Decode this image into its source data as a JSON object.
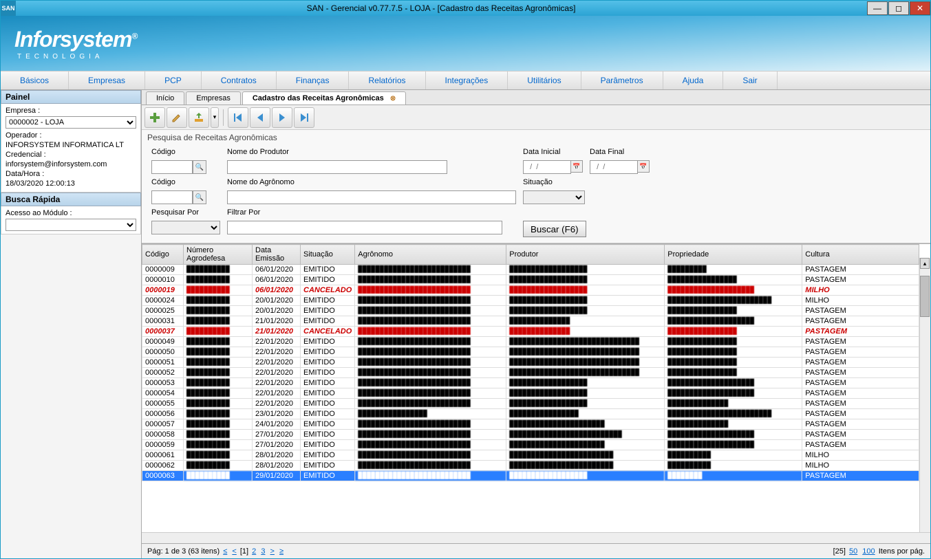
{
  "window": {
    "app_icon_text": "SAN",
    "title": "SAN - Gerencial v0.77.7.5 - LOJA - [Cadastro das Receitas Agronômicas]"
  },
  "logo": {
    "brand": "Inforsystem",
    "reg": "®",
    "sub": "TECNOLOGIA"
  },
  "menu": [
    "Básicos",
    "Empresas",
    "PCP",
    "Contratos",
    "Finanças",
    "Relatórios",
    "Integrações",
    "Utilitários",
    "Parâmetros",
    "Ajuda",
    "Sair"
  ],
  "side": {
    "panel_title": "Painel",
    "empresa_label": "Empresa :",
    "empresa_value": "0000002 - LOJA",
    "operador_label": "Operador :",
    "operador_value": "INFORSYSTEM INFORMATICA LT",
    "credencial_label": "Credencial :",
    "credencial_value": "inforsystem@inforsystem.com",
    "datahora_label": "Data/Hora :",
    "datahora_value": "18/03/2020 12:00:13",
    "busca_title": "Busca Rápida",
    "busca_label": "Acesso ao Módulo :"
  },
  "tabs": [
    {
      "label": "Início",
      "active": false,
      "closable": false
    },
    {
      "label": "Empresas",
      "active": false,
      "closable": false
    },
    {
      "label": "Cadastro das Receitas Agronômicas",
      "active": true,
      "closable": true
    }
  ],
  "form": {
    "heading": "Pesquisa de Receitas Agronômicas",
    "codigo_label": "Código",
    "produtor_label": "Nome do Produtor",
    "datai_label": "Data Inicial",
    "dataf_label": "Data Final",
    "date_placeholder": "  /  /",
    "agronomo_label": "Nome do Agrônomo",
    "situacao_label": "Situação",
    "pesquisar_label": "Pesquisar Por",
    "filtrar_label": "Filtrar Por",
    "buscar_label": "Buscar (F6)"
  },
  "grid": {
    "columns": [
      "Código",
      "Número Agrodefesa",
      "Data Emissão",
      "Situação",
      "Agrônomo",
      "Produtor",
      "Propriedade",
      "Cultura"
    ],
    "rows": [
      {
        "c": "0000009",
        "n": "██████████",
        "d": "06/01/2020",
        "s": "EMITIDO",
        "ag": "██████████████████████████",
        "pr": "██████████████████",
        "pp": "█████████",
        "cu": "PASTAGEM",
        "cancel": false,
        "sel": false
      },
      {
        "c": "0000010",
        "n": "██████████",
        "d": "06/01/2020",
        "s": "EMITIDO",
        "ag": "██████████████████████████",
        "pr": "██████████████████",
        "pp": "████████████████",
        "cu": "PASTAGEM",
        "cancel": false,
        "sel": false
      },
      {
        "c": "0000019",
        "n": "██████████",
        "d": "06/01/2020",
        "s": "CANCELADO",
        "ag": "██████████████████████████",
        "pr": "██████████████████",
        "pp": "████████████████████",
        "cu": "MILHO",
        "cancel": true,
        "sel": false
      },
      {
        "c": "0000024",
        "n": "██████████",
        "d": "20/01/2020",
        "s": "EMITIDO",
        "ag": "██████████████████████████",
        "pr": "██████████████████",
        "pp": "████████████████████████",
        "cu": "MILHO",
        "cancel": false,
        "sel": false
      },
      {
        "c": "0000025",
        "n": "██████████",
        "d": "20/01/2020",
        "s": "EMITIDO",
        "ag": "██████████████████████████",
        "pr": "██████████████████",
        "pp": "████████████████",
        "cu": "PASTAGEM",
        "cancel": false,
        "sel": false
      },
      {
        "c": "0000031",
        "n": "██████████",
        "d": "21/01/2020",
        "s": "EMITIDO",
        "ag": "██████████████████████████",
        "pr": "██████████████",
        "pp": "████████████████████",
        "cu": "PASTAGEM",
        "cancel": false,
        "sel": false
      },
      {
        "c": "0000037",
        "n": "██████████",
        "d": "21/01/2020",
        "s": "CANCELADO",
        "ag": "██████████████████████████",
        "pr": "██████████████",
        "pp": "████████████████",
        "cu": "PASTAGEM",
        "cancel": true,
        "sel": false
      },
      {
        "c": "0000049",
        "n": "██████████",
        "d": "22/01/2020",
        "s": "EMITIDO",
        "ag": "██████████████████████████",
        "pr": "██████████████████████████████",
        "pp": "████████████████",
        "cu": "PASTAGEM",
        "cancel": false,
        "sel": false
      },
      {
        "c": "0000050",
        "n": "██████████",
        "d": "22/01/2020",
        "s": "EMITIDO",
        "ag": "██████████████████████████",
        "pr": "██████████████████████████████",
        "pp": "████████████████",
        "cu": "PASTAGEM",
        "cancel": false,
        "sel": false
      },
      {
        "c": "0000051",
        "n": "██████████",
        "d": "22/01/2020",
        "s": "EMITIDO",
        "ag": "██████████████████████████",
        "pr": "██████████████████████████████",
        "pp": "████████████████",
        "cu": "PASTAGEM",
        "cancel": false,
        "sel": false
      },
      {
        "c": "0000052",
        "n": "██████████",
        "d": "22/01/2020",
        "s": "EMITIDO",
        "ag": "██████████████████████████",
        "pr": "██████████████████████████████",
        "pp": "████████████████",
        "cu": "PASTAGEM",
        "cancel": false,
        "sel": false
      },
      {
        "c": "0000053",
        "n": "██████████",
        "d": "22/01/2020",
        "s": "EMITIDO",
        "ag": "██████████████████████████",
        "pr": "██████████████████",
        "pp": "████████████████████",
        "cu": "PASTAGEM",
        "cancel": false,
        "sel": false
      },
      {
        "c": "0000054",
        "n": "██████████",
        "d": "22/01/2020",
        "s": "EMITIDO",
        "ag": "██████████████████████████",
        "pr": "██████████████████",
        "pp": "████████████████████",
        "cu": "PASTAGEM",
        "cancel": false,
        "sel": false
      },
      {
        "c": "0000055",
        "n": "██████████",
        "d": "22/01/2020",
        "s": "EMITIDO",
        "ag": "██████████████████████████",
        "pr": "██████████████████",
        "pp": "██████████████",
        "cu": "PASTAGEM",
        "cancel": false,
        "sel": false
      },
      {
        "c": "0000056",
        "n": "██████████",
        "d": "23/01/2020",
        "s": "EMITIDO",
        "ag": "████████████████",
        "pr": "████████████████",
        "pp": "████████████████████████",
        "cu": "PASTAGEM",
        "cancel": false,
        "sel": false
      },
      {
        "c": "0000057",
        "n": "██████████",
        "d": "24/01/2020",
        "s": "EMITIDO",
        "ag": "██████████████████████████",
        "pr": "██████████████████████",
        "pp": "██████████████",
        "cu": "PASTAGEM",
        "cancel": false,
        "sel": false
      },
      {
        "c": "0000058",
        "n": "██████████",
        "d": "27/01/2020",
        "s": "EMITIDO",
        "ag": "██████████████████████████",
        "pr": "██████████████████████████",
        "pp": "████████████████████",
        "cu": "PASTAGEM",
        "cancel": false,
        "sel": false
      },
      {
        "c": "0000059",
        "n": "██████████",
        "d": "27/01/2020",
        "s": "EMITIDO",
        "ag": "██████████████████████████",
        "pr": "██████████████████████",
        "pp": "████████████████████",
        "cu": "PASTAGEM",
        "cancel": false,
        "sel": false
      },
      {
        "c": "0000061",
        "n": "██████████",
        "d": "28/01/2020",
        "s": "EMITIDO",
        "ag": "██████████████████████████",
        "pr": "████████████████████████",
        "pp": "██████████",
        "cu": "MILHO",
        "cancel": false,
        "sel": false
      },
      {
        "c": "0000062",
        "n": "██████████",
        "d": "28/01/2020",
        "s": "EMITIDO",
        "ag": "██████████████████████████",
        "pr": "████████████████████████",
        "pp": "██████████",
        "cu": "MILHO",
        "cancel": false,
        "sel": false
      },
      {
        "c": "0000063",
        "n": "██████████",
        "d": "29/01/2020",
        "s": "EMITIDO",
        "ag": "██████████████████████████",
        "pr": "██████████████████",
        "pp": "████████",
        "cu": "PASTAGEM",
        "cancel": false,
        "sel": true
      }
    ]
  },
  "pager": {
    "left_prefix": "Pág: 1 de 3 (63 itens)  ",
    "lt_lt": "≤",
    "lt": "<",
    "p1": "[1]",
    "p2": "2",
    "p3": "3",
    "gt": ">",
    "gt_gt": "≥",
    "right_prefix": "[25]  ",
    "r50": "50",
    "r100": "100",
    "right_suffix": "  Itens por pág."
  }
}
